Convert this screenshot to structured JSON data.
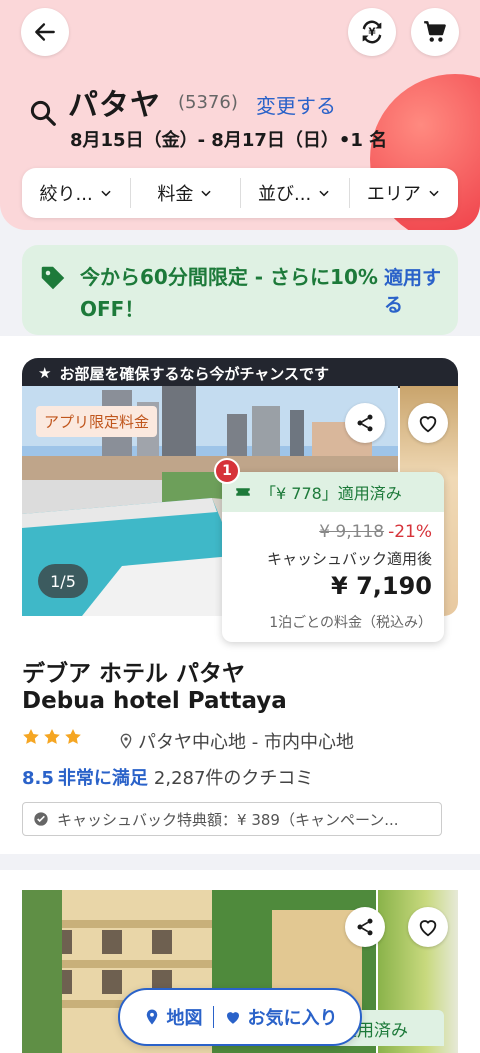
{
  "header": {
    "destination": "パタヤ",
    "result_count": "(5376)",
    "change_label": "変更する",
    "dates_guests": "8月15日（金）- 8月17日（日）•1 名"
  },
  "filters": [
    {
      "label": "絞り..."
    },
    {
      "label": "料金"
    },
    {
      "label": "並び..."
    },
    {
      "label": "エリア"
    }
  ],
  "promo": {
    "message": "今から60分間限定 - さらに10% OFF！",
    "apply_label": "適用する"
  },
  "listing1": {
    "banner": "お部屋を確保するなら今がチャンスです",
    "app_badge": "アプリ限定料金",
    "photo_counter": "1/5",
    "notification_count": "1",
    "coupon_applied": "「¥ 778」適用済み",
    "original_price": "¥ 9,118",
    "discount": "-21%",
    "after_cashback": "キャッシュバック適用後",
    "final_price": "¥ 7,190",
    "per_night": "1泊ごとの料金（税込み）",
    "name_ja": "デブア ホテル パタヤ",
    "name_en": "Debua hotel Pattaya",
    "star_rating": 3.5,
    "location": "パタヤ中心地 - 市内中心地",
    "score": "8.5",
    "verdict": "非常に満足",
    "reviews": "2,287件のクチコミ",
    "cashback_note": "キャッシュバック特典額：¥ 389（キャンペーン..."
  },
  "listing2": {
    "coupon_applied": "適用済み"
  },
  "floating": {
    "map_label": "地図",
    "favorites_label": "お気に入り"
  },
  "colors": {
    "brand_blue": "#2a62c9",
    "promo_green": "#1d7a3a",
    "discount_red": "#d6333a",
    "header_pink": "#fbd7d9"
  }
}
